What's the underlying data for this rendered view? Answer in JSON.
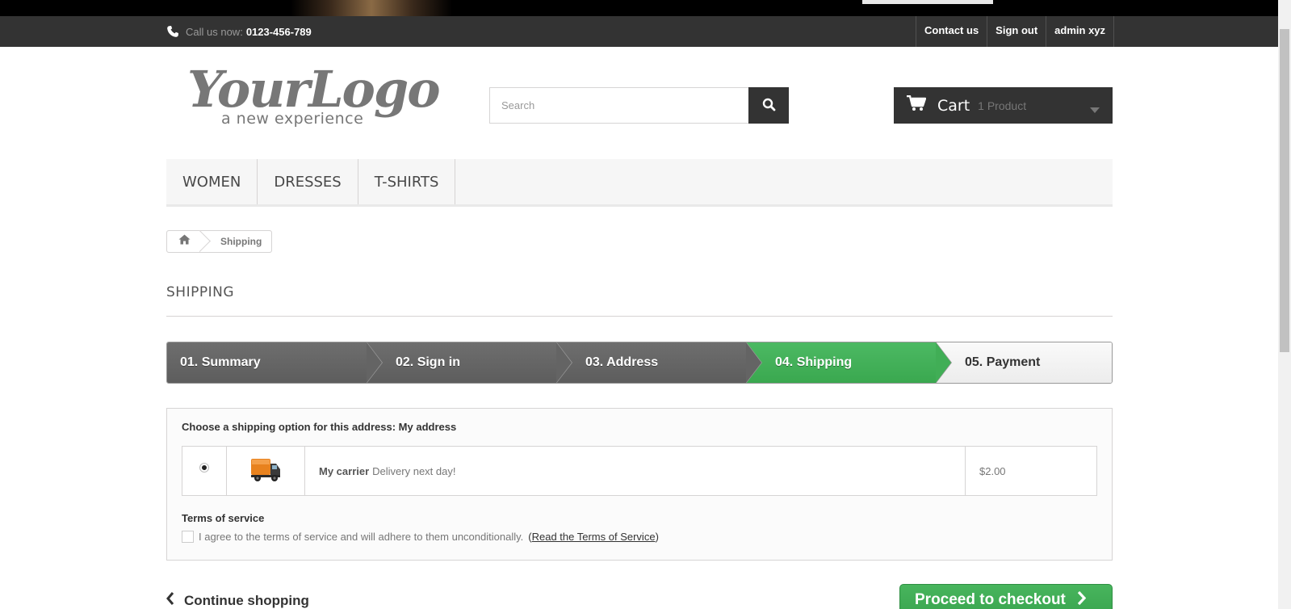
{
  "topbar": {
    "call_label": "Call us now:",
    "phone": "0123-456-789",
    "links": [
      "Contact us",
      "Sign out",
      "admin xyz"
    ]
  },
  "header": {
    "logo_script": "YourLogo",
    "logo_tagline": "a new experience",
    "search_placeholder": "Search",
    "cart_label": "Cart",
    "cart_qty": "1 Product"
  },
  "menu": [
    "WOMEN",
    "DRESSES",
    "T-SHIRTS"
  ],
  "breadcrumb": {
    "current": "Shipping"
  },
  "page_title": "SHIPPING",
  "steps": [
    {
      "label": "01. Summary",
      "state": "done"
    },
    {
      "label": "02. Sign in",
      "state": "done"
    },
    {
      "label": "03. Address",
      "state": "done"
    },
    {
      "label": "04. Shipping",
      "state": "current"
    },
    {
      "label": "05. Payment",
      "state": "todo"
    }
  ],
  "shipping": {
    "title": "Choose a shipping option for this address: My address",
    "carrier_name": "My carrier",
    "carrier_delay": "Delivery next day!",
    "carrier_price": "$2.00",
    "selected": true
  },
  "terms": {
    "title": "Terms of service",
    "agree_text": "I agree to the terms of service and will adhere to them unconditionally.",
    "link_text": "Read the Terms of Service",
    "checked": false
  },
  "actions": {
    "continue": "Continue shopping",
    "checkout": "Proceed to checkout"
  },
  "colors": {
    "accent_green": "#43b155",
    "dark": "#333333"
  }
}
